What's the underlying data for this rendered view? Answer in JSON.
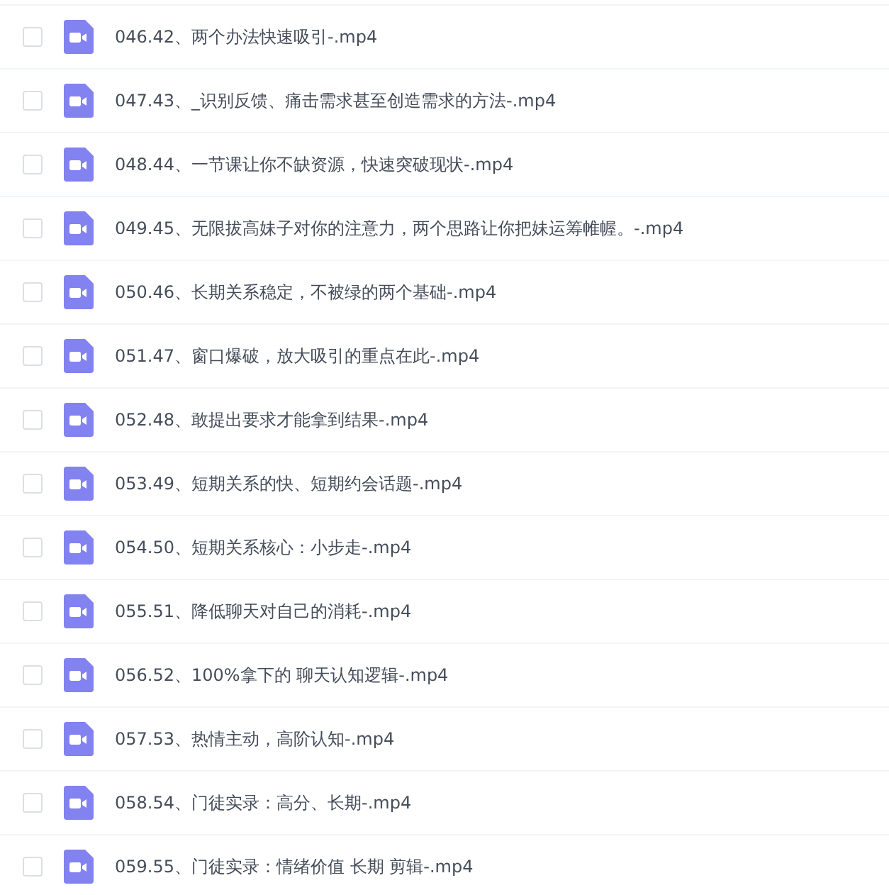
{
  "files": [
    {
      "name": "046.42、两个办法快速吸引-.mp4",
      "checked": false
    },
    {
      "name": "047.43、_识别反馈、痛击需求甚至创造需求的方法-.mp4",
      "checked": false
    },
    {
      "name": "048.44、一节课让你不缺资源，快速突破现状-.mp4",
      "checked": false
    },
    {
      "name": "049.45、无限拔高妹子对你的注意力，两个思路让你把妹运筹帷幄。-.mp4",
      "checked": false
    },
    {
      "name": "050.46、长期关系稳定，不被绿的两个基础-.mp4",
      "checked": false
    },
    {
      "name": "051.47、窗口爆破，放大吸引的重点在此-.mp4",
      "checked": false
    },
    {
      "name": "052.48、敢提出要求才能拿到结果-.mp4",
      "checked": false
    },
    {
      "name": "053.49、短期关系的快、短期约会话题-.mp4",
      "checked": false
    },
    {
      "name": "054.50、短期关系核心：小步走-.mp4",
      "checked": false
    },
    {
      "name": "055.51、降低聊天对自己的消耗-.mp4",
      "checked": false
    },
    {
      "name": "056.52、100%拿下的 聊天认知逻辑-.mp4",
      "checked": false
    },
    {
      "name": "057.53、热情主动，高阶认知-.mp4",
      "checked": false
    },
    {
      "name": "058.54、门徒实录：高分、长期-.mp4",
      "checked": false
    },
    {
      "name": "059.55、门徒实录：情绪价值 长期 剪辑-.mp4",
      "checked": false
    }
  ]
}
